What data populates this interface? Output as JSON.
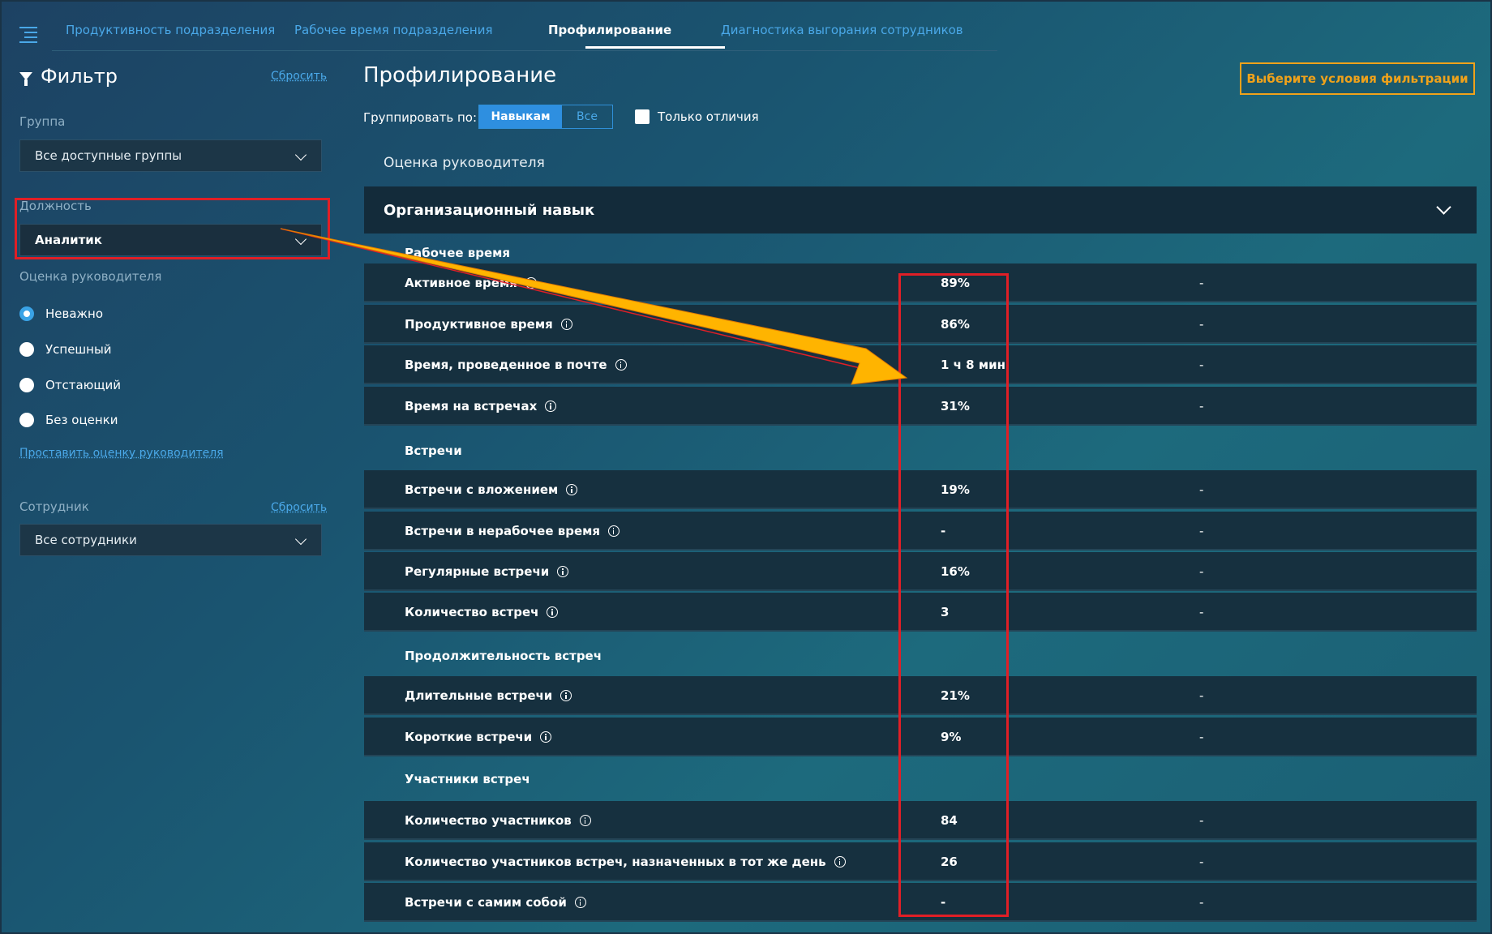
{
  "nav": {
    "tabs": [
      {
        "label": "Продуктивность подразделения",
        "active": false
      },
      {
        "label": "Рабочее время подразделения",
        "active": false
      },
      {
        "label": "Профилирование",
        "active": true
      },
      {
        "label": "Диагностика выгорания сотрудников",
        "active": false
      }
    ]
  },
  "sidebar": {
    "title": "Фильтр",
    "reset_label": "Сбросить",
    "group": {
      "label": "Группа",
      "value": "Все доступные группы"
    },
    "position": {
      "label": "Должность",
      "value": "Аналитик"
    },
    "rating": {
      "label": "Оценка руководителя",
      "options": [
        "Неважно",
        "Успешный",
        "Отстающий",
        "Без оценки"
      ],
      "selected": "Неважно"
    },
    "set_rating_link": "Проставить оценку руководителя",
    "employee": {
      "label": "Сотрудник",
      "reset_label": "Сбросить",
      "value": "Все сотрудники"
    }
  },
  "main": {
    "title": "Профилирование",
    "filter_button": "Выберите условия фильтрации",
    "group_by_label": "Группировать по:",
    "group_by_options": [
      "Навыкам",
      "Все"
    ],
    "only_diff_label": "Только отличия",
    "section_label": "Оценка руководителя",
    "accordion_title": "Организационный навык",
    "rows": [
      {
        "type": "header",
        "name": "Рабочее время"
      },
      {
        "type": "data",
        "name": "Активное время",
        "value": "89%",
        "value2": "-"
      },
      {
        "type": "data",
        "name": "Продуктивное время",
        "value": "86%",
        "value2": "-"
      },
      {
        "type": "data",
        "name": "Время, проведенное в почте",
        "value": "1 ч 8 мин",
        "value2": "-"
      },
      {
        "type": "data",
        "name": "Время на встречах",
        "value": "31%",
        "value2": "-"
      },
      {
        "type": "header",
        "name": "Встречи"
      },
      {
        "type": "data",
        "name": "Встречи с вложением",
        "value": "19%",
        "value2": "-"
      },
      {
        "type": "data",
        "name": "Встречи в нерабочее время",
        "value": "-",
        "value2": "-"
      },
      {
        "type": "data",
        "name": "Регулярные встречи",
        "value": "16%",
        "value2": "-"
      },
      {
        "type": "data",
        "name": "Количество встреч",
        "value": "3",
        "value2": "-"
      },
      {
        "type": "header",
        "name": "Продолжительность встреч"
      },
      {
        "type": "data",
        "name": "Длительные встречи",
        "value": "21%",
        "value2": "-"
      },
      {
        "type": "data",
        "name": "Короткие встречи",
        "value": "9%",
        "value2": "-"
      },
      {
        "type": "header",
        "name": "Участники встреч"
      },
      {
        "type": "data",
        "name": "Количество участников",
        "value": "84",
        "value2": "-"
      },
      {
        "type": "data",
        "name": "Количество участников встреч, назначенных в тот же день",
        "value": "26",
        "value2": "-"
      },
      {
        "type": "data",
        "name": "Встречи с самим собой",
        "value": "-",
        "value2": "-"
      }
    ]
  },
  "colors": {
    "accent": "#2e8fe0",
    "link": "#4aa8e8",
    "warning": "#f0a21a",
    "highlight": "#e01f26",
    "arrow": "#ffb400"
  }
}
